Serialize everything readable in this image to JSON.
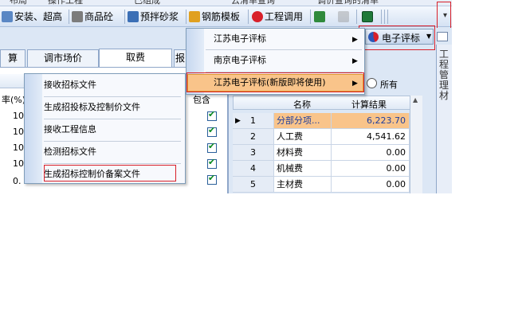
{
  "menubar": {
    "items": [
      "布局",
      "操作工程",
      "已组成",
      "云清单查询",
      "调价查询的清单"
    ]
  },
  "toolbar": {
    "items": [
      "安装、超高",
      "商品砼",
      "预拌砂浆",
      "钢筋模板",
      "工程调用"
    ],
    "overflow_label": "▾"
  },
  "colors": {
    "accent": "#1f3f9e",
    "highlight": "#f9c48a",
    "danger": "#d8202a"
  },
  "tabs": [
    "算",
    "调市场价",
    "取费",
    "报"
  ],
  "left_table": {
    "header_left": "率(%)",
    "header_include": "包含",
    "rows": [
      {
        "rate": "10"
      },
      {
        "rate": "10"
      },
      {
        "rate": "10"
      },
      {
        "rate": "10"
      },
      {
        "rate": "0."
      }
    ]
  },
  "bid_menu": {
    "items": [
      "接收招标文件",
      "生成招投标及控制价文件",
      "接收工程信息",
      "检测招标文件",
      "生成招标控制价备案文件"
    ]
  },
  "eval_dropdown": {
    "label": "电子评标"
  },
  "eval_menu": {
    "items": [
      "江苏电子评标",
      "南京电子评标",
      "江苏电子评标(新版即将使用)"
    ]
  },
  "radio": {
    "label": "所有"
  },
  "right_table": {
    "headers": [
      "名称",
      "计算结果"
    ],
    "rows": [
      {
        "no": "1",
        "name": "分部分项...",
        "value": "6,223.70"
      },
      {
        "no": "2",
        "name": "人工费",
        "value": "4,541.62"
      },
      {
        "no": "3",
        "name": "材料费",
        "value": "0.00"
      },
      {
        "no": "4",
        "name": "机械费",
        "value": "0.00"
      },
      {
        "no": "5",
        "name": "主材费",
        "value": "0.00"
      }
    ]
  },
  "sidebar": {
    "label": "工程管理材"
  }
}
